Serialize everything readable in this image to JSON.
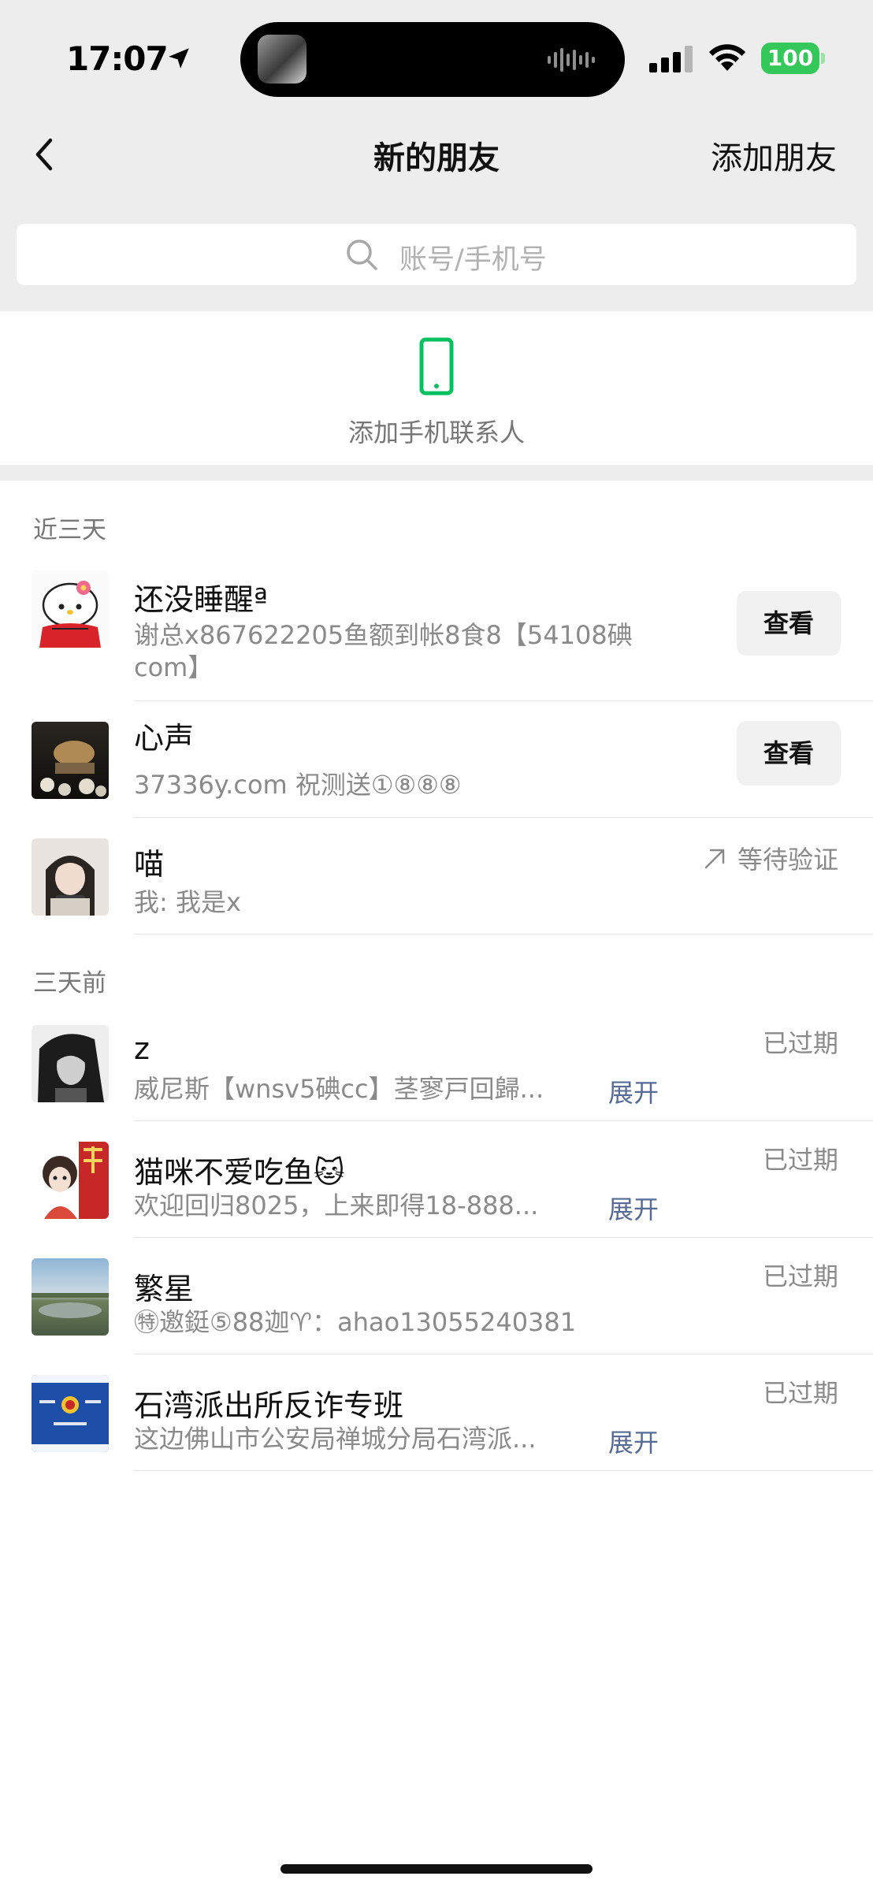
{
  "status_bar": {
    "time": "17:07",
    "battery": "100",
    "icons": [
      "location-arrow-icon",
      "audio-wave-icon",
      "signal-icon",
      "wifi-icon",
      "battery-icon"
    ],
    "battery_color": "#34c759"
  },
  "nav": {
    "back_icon": "chevron-left-icon",
    "title": "新的朋友",
    "action": "添加朋友"
  },
  "search": {
    "placeholder": "账号/手机号",
    "icon": "search-icon"
  },
  "add_phone": {
    "label": "添加手机联系人",
    "icon": "mobile-phone-icon",
    "icon_color": "#07c160"
  },
  "sections": {
    "recent": "近三天",
    "older": "三天前"
  },
  "recent_requests": [
    {
      "name": "还没睡醒ª",
      "message": "谢总x867622205鱼额到帐8食8【54108碘com】",
      "action": "查看"
    },
    {
      "name": "心声",
      "message": "37336y.com  祝测送①⑧⑧⑧",
      "action": "查看"
    },
    {
      "name": "喵",
      "message": "我: 我是x",
      "status": "等待验证"
    }
  ],
  "older_requests": [
    {
      "name": "z",
      "message": "威尼斯【wnsv5碘cc】茎寥戸回歸...",
      "status": "已过期",
      "expand": "展开"
    },
    {
      "name": "猫咪不爱吃鱼🐱",
      "message": "欢迎回归8025，上来即得18-888...",
      "status": "已过期",
      "expand": "展开"
    },
    {
      "name": "繁星",
      "message": "㊕邀鋌⑤88迦♈：ahao13055240381",
      "status": "已过期"
    },
    {
      "name": "石湾派出所反诈专班",
      "message": "这边佛山市公安局禅城分局石湾派...",
      "status": "已过期",
      "expand": "展开"
    }
  ],
  "colors": {
    "background_gray": "#ededed",
    "link_blue": "#576b95",
    "secondary_text": "#8a8a8a"
  }
}
